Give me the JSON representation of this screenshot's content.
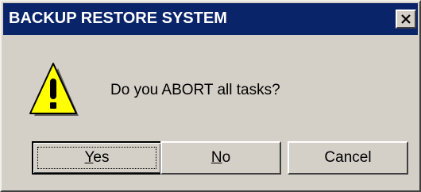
{
  "window": {
    "title": "BACKUP RESTORE SYSTEM",
    "close_icon": "close-icon",
    "colors": {
      "titlebar": "#0a246a",
      "title_text": "#ffffff",
      "dialog_bg": "#d4d0c8"
    }
  },
  "dialog": {
    "icon": "warning-icon",
    "message": "Do you ABORT all tasks?"
  },
  "buttons": {
    "yes": {
      "mnemonic": "Y",
      "rest": "es"
    },
    "no": {
      "mnemonic": "N",
      "rest": "o"
    },
    "cancel": {
      "label": "Cancel"
    }
  }
}
